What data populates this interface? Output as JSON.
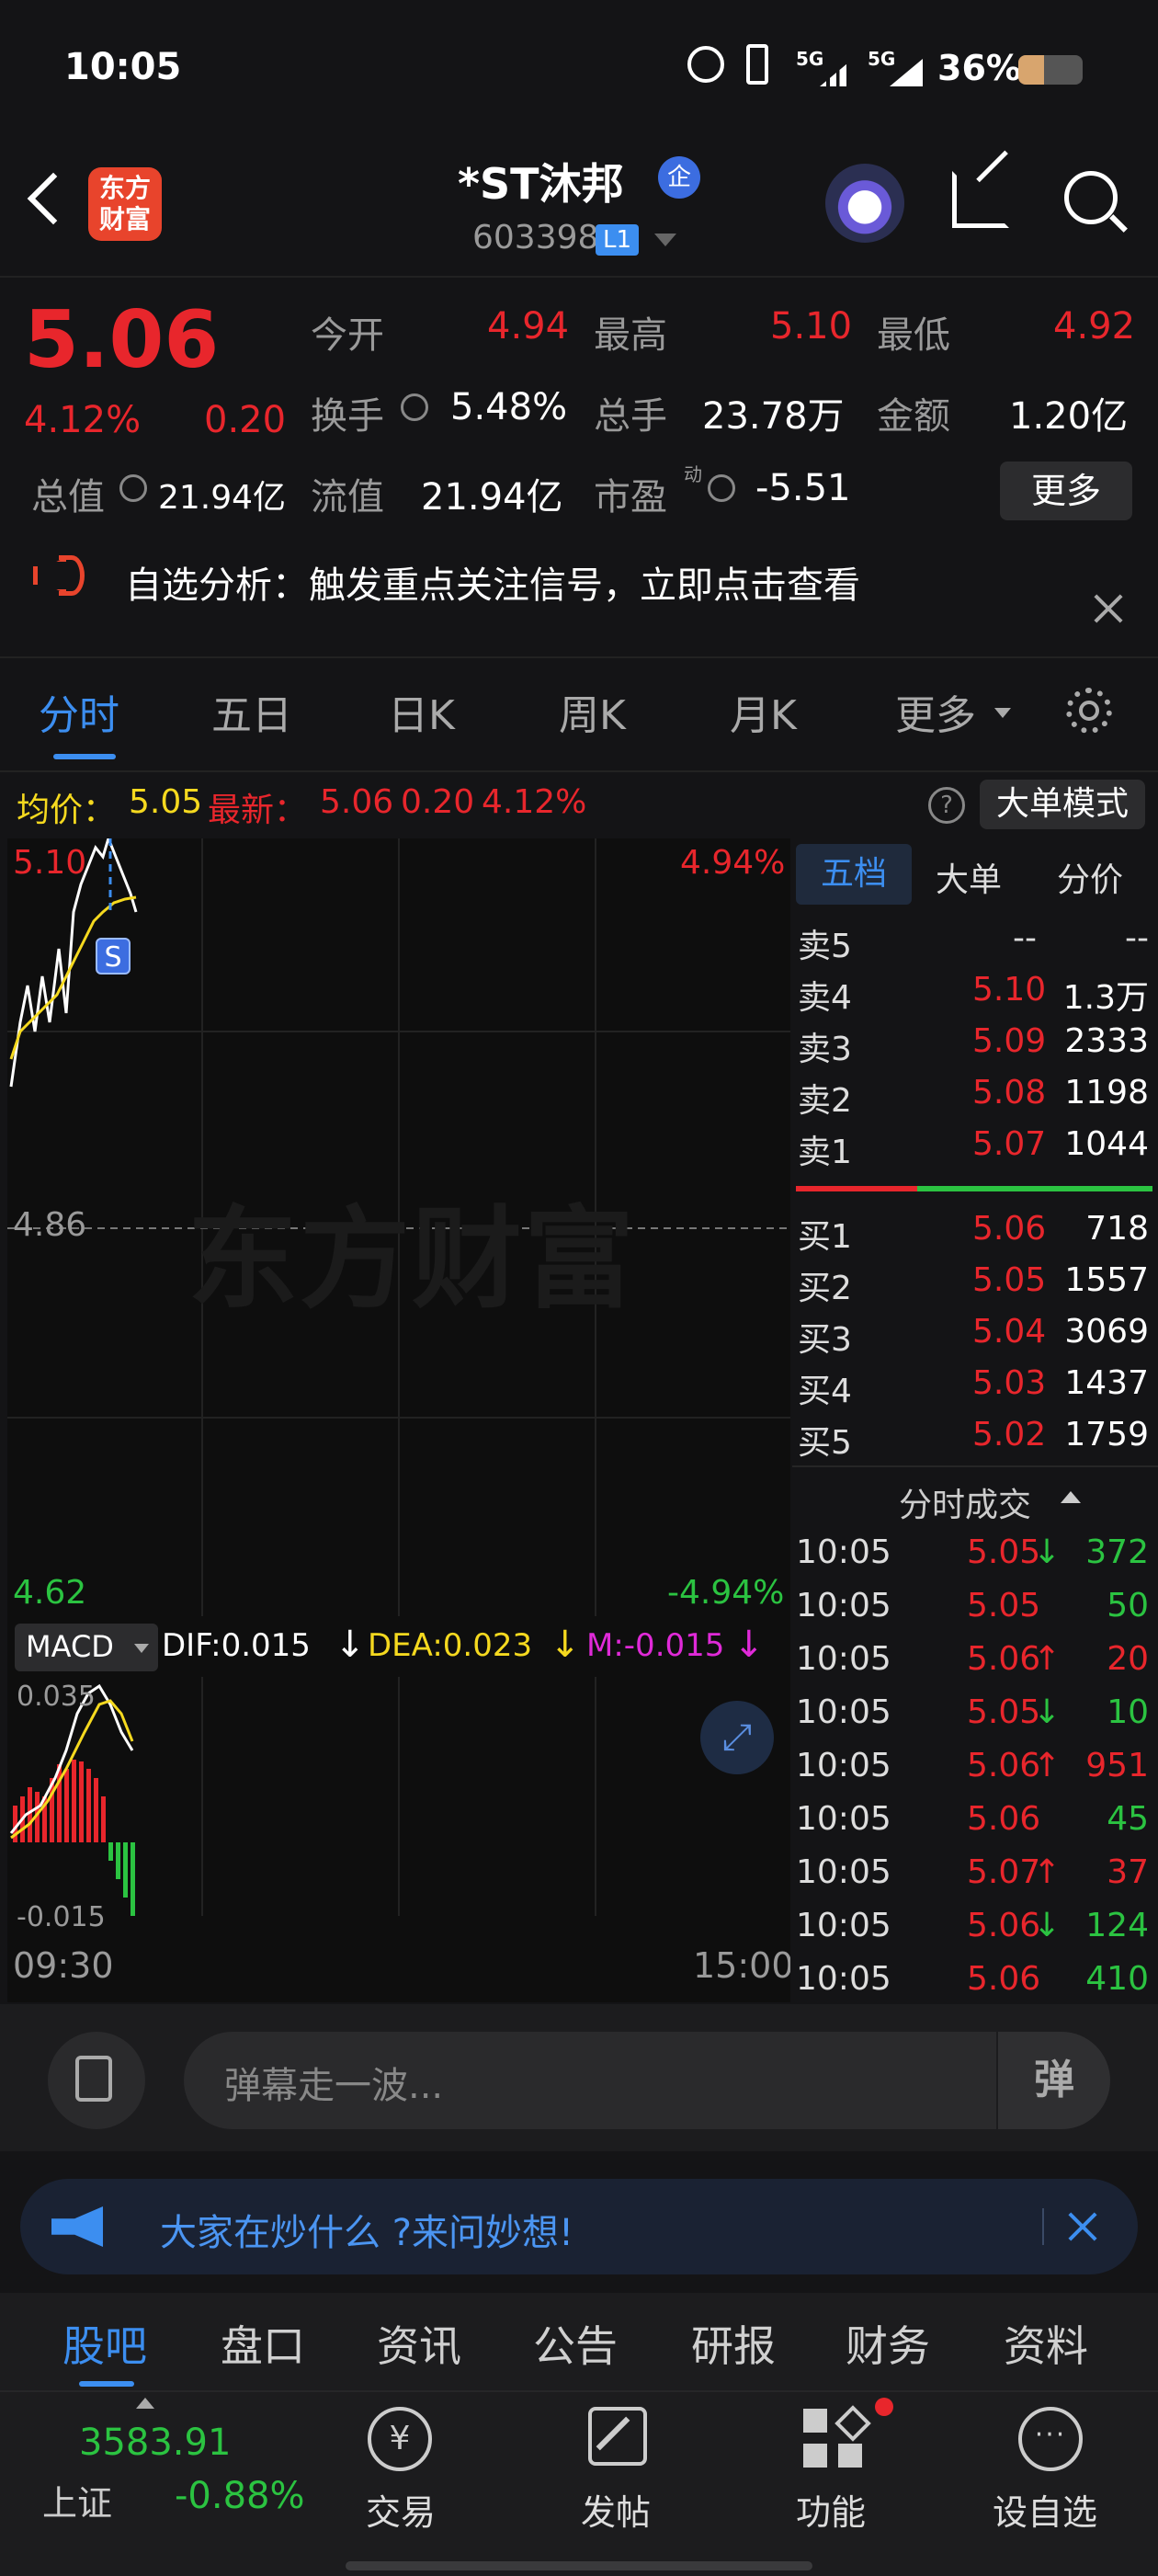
{
  "status_bar": {
    "time": "10:05",
    "signal1": "5G",
    "signal2": "5G",
    "battery": "36%"
  },
  "header": {
    "app_logo": "东方\n财富",
    "stock_name": "*ST沐邦",
    "badge": "企",
    "code": "603398",
    "level": "L1"
  },
  "quote": {
    "price": "5.06",
    "change_pct": "4.12%",
    "change": "0.20",
    "open_label": "今开",
    "open": "4.94",
    "high_label": "最高",
    "high": "5.10",
    "low_label": "最低",
    "low": "4.92",
    "turnover_label": "换手",
    "turnover": "5.48%",
    "volume_label": "总手",
    "volume": "23.78万",
    "amount_label": "金额",
    "amount": "1.20亿",
    "mktcap_label": "总值",
    "mktcap": "21.94亿",
    "float_label": "流值",
    "float_cap": "21.94亿",
    "pe_label": "市盈",
    "pe_sup": "动",
    "pe": "-5.51",
    "more_button": "更多"
  },
  "banner": {
    "text": "自选分析：触发重点关注信号，立即点击查看"
  },
  "chart_tabs": [
    "分时",
    "五日",
    "日K",
    "周K",
    "月K",
    "更多"
  ],
  "chart_info": {
    "avg_label": "均价：",
    "avg": "5.05",
    "latest_label": "最新：",
    "latest": "5.06",
    "latest_change": "0.20",
    "latest_pct": "4.12%",
    "big_order_mode": "大单模式",
    "y_top": "5.10",
    "y_top_pct": "4.94%",
    "y_mid": "4.86",
    "y_bottom": "4.62",
    "y_bottom_pct": "-4.94%",
    "watermark": "东方财富",
    "s_marker": "S"
  },
  "macd": {
    "selector": "MACD",
    "dif": "DIF:0.015",
    "dea": "DEA:0.023",
    "m": "M:-0.015",
    "y_top": "0.035",
    "y_bottom": "-0.015",
    "x_start": "09:30",
    "x_end": "15:00"
  },
  "order_book": {
    "tabs": [
      "五档",
      "大单",
      "分价"
    ],
    "asks": [
      {
        "label": "卖5",
        "price": "--",
        "vol": "--"
      },
      {
        "label": "卖4",
        "price": "5.10",
        "vol": "1.3万"
      },
      {
        "label": "卖3",
        "price": "5.09",
        "vol": "2333"
      },
      {
        "label": "卖2",
        "price": "5.08",
        "vol": "1198"
      },
      {
        "label": "卖1",
        "price": "5.07",
        "vol": "1044"
      }
    ],
    "bids": [
      {
        "label": "买1",
        "price": "5.06",
        "vol": "718"
      },
      {
        "label": "买2",
        "price": "5.05",
        "vol": "1557"
      },
      {
        "label": "买3",
        "price": "5.04",
        "vol": "3069"
      },
      {
        "label": "买4",
        "price": "5.03",
        "vol": "1437"
      },
      {
        "label": "买5",
        "price": "5.02",
        "vol": "1759"
      }
    ],
    "trades_header": "分时成交",
    "trades": [
      {
        "time": "10:05",
        "price": "5.05",
        "dir": "↓",
        "vol": "372",
        "vol_color": "green"
      },
      {
        "time": "10:05",
        "price": "5.05",
        "dir": "",
        "vol": "50",
        "vol_color": "green"
      },
      {
        "time": "10:05",
        "price": "5.06",
        "dir": "↑",
        "vol": "20",
        "vol_color": "red"
      },
      {
        "time": "10:05",
        "price": "5.05",
        "dir": "↓",
        "vol": "10",
        "vol_color": "green"
      },
      {
        "time": "10:05",
        "price": "5.06",
        "dir": "↑",
        "vol": "951",
        "vol_color": "red"
      },
      {
        "time": "10:05",
        "price": "5.06",
        "dir": "",
        "vol": "45",
        "vol_color": "green"
      },
      {
        "time": "10:05",
        "price": "5.07",
        "dir": "↑",
        "vol": "37",
        "vol_color": "red"
      },
      {
        "time": "10:05",
        "price": "5.06",
        "dir": "↓",
        "vol": "124",
        "vol_color": "green"
      },
      {
        "time": "10:05",
        "price": "5.06",
        "dir": "",
        "vol": "410",
        "vol_color": "green"
      }
    ]
  },
  "danmaku": {
    "placeholder": "弹幕走一波...",
    "button": "弹"
  },
  "promo": {
    "text": "大家在炒什么 ?来问妙想!"
  },
  "section_tabs": [
    "股吧",
    "盘口",
    "资讯",
    "公告",
    "研报",
    "财务",
    "资料"
  ],
  "dock": {
    "index_value": "3583.91",
    "index_name": "上证",
    "index_change": "-0.88%",
    "items": [
      "交易",
      "发帖",
      "功能",
      "设自选"
    ]
  },
  "colors": {
    "red": "#e8262c",
    "green": "#2bc341",
    "blue": "#3c8ef0",
    "yellow": "#f5d91f"
  }
}
